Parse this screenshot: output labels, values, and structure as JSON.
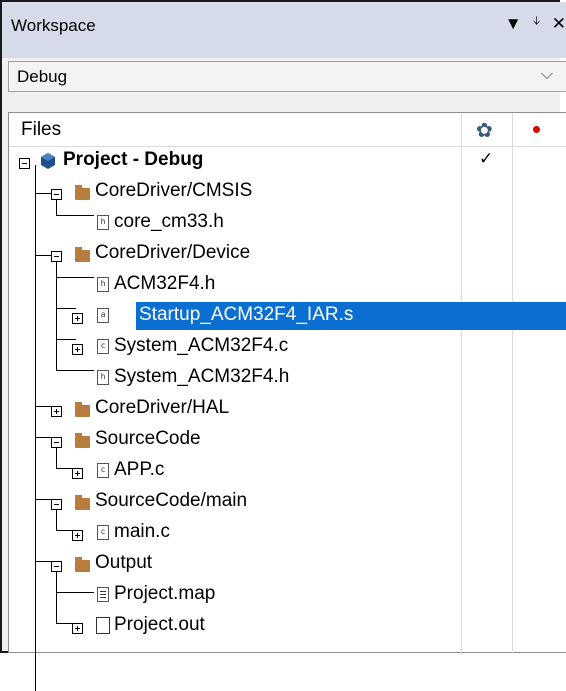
{
  "workspace": {
    "title": "Workspace",
    "title_icons": [
      "dropdown-arrow-icon",
      "pin-icon",
      "close-icon"
    ],
    "config_selected": "Debug"
  },
  "tree": {
    "header_label": "Files",
    "header_col1_icon": "gear-icon",
    "header_col2_icon": "red-dot-icon",
    "rows": [
      {
        "label": "Project - Debug",
        "icon": "project-cube-icon",
        "check": "✓"
      },
      {
        "label": "CoreDriver/CMSIS",
        "icon": "folder-icon"
      },
      {
        "label": "core_cm33.h",
        "icon": "header-file-icon"
      },
      {
        "label": "CoreDriver/Device",
        "icon": "folder-icon"
      },
      {
        "label": "ACM32F4.h",
        "icon": "header-file-icon"
      },
      {
        "label": "Startup_ACM32F4_IAR.s",
        "icon": "asm-file-icon",
        "selected": true
      },
      {
        "label": "System_ACM32F4.c",
        "icon": "c-file-icon"
      },
      {
        "label": "System_ACM32F4.h",
        "icon": "header-file-icon"
      },
      {
        "label": "CoreDriver/HAL",
        "icon": "folder-icon"
      },
      {
        "label": "SourceCode",
        "icon": "folder-icon"
      },
      {
        "label": "APP.c",
        "icon": "c-file-icon"
      },
      {
        "label": "SourceCode/main",
        "icon": "folder-icon"
      },
      {
        "label": "main.c",
        "icon": "c-file-icon"
      },
      {
        "label": "Output",
        "icon": "folder-icon"
      },
      {
        "label": "Project.map",
        "icon": "map-file-icon"
      },
      {
        "label": "Project.out",
        "icon": "output-file-icon"
      }
    ]
  }
}
